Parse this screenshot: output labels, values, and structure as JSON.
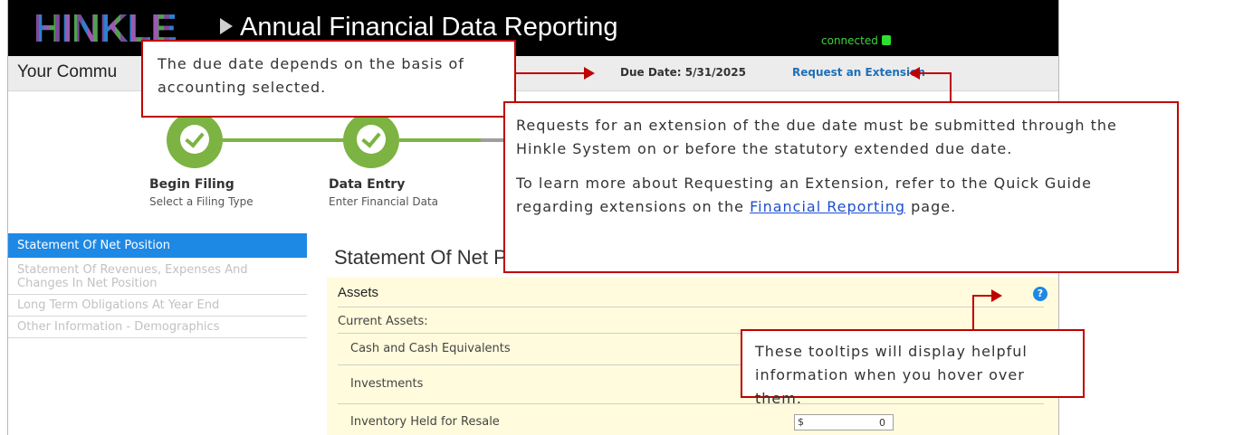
{
  "app": {
    "logo_text": "HINKLE",
    "title": "Annual Financial Data Reporting",
    "connection_status": "connected",
    "connection_color": "#2ee02e"
  },
  "subheader": {
    "community_label": "Your Commu",
    "due_date": "Due Date: 5/31/2025",
    "extension_link": "Request an Extension"
  },
  "steps": [
    {
      "title": "Begin Filing",
      "subtitle": "Select a Filing Type",
      "status": "complete",
      "icon": "check-icon"
    },
    {
      "title": "Data Entry",
      "subtitle": "Enter Financial Data",
      "status": "complete",
      "icon": "check-icon"
    }
  ],
  "sidebar": {
    "items": [
      {
        "label": "Statement Of Net Position",
        "active": true
      },
      {
        "label": "Statement Of Revenues, Expenses And Changes In Net Position",
        "active": false
      },
      {
        "label": "Long Term Obligations At Year End",
        "active": false
      },
      {
        "label": "Other Information - Demographics",
        "active": false
      }
    ]
  },
  "main": {
    "section_title": "Statement Of Net Pos",
    "group_title": "Assets",
    "subgroup_title": "Current Assets:",
    "rows": [
      {
        "label": "Cash and Cash Equivalents"
      },
      {
        "label": "Investments"
      },
      {
        "label": "Inventory Held for Resale",
        "currency": "$",
        "value": "0"
      }
    ],
    "help_icon_label": "?"
  },
  "callouts": {
    "due_date_note": "The due date depends on the basis of accounting selected.",
    "extension_note_p1": "Requests for an extension of the due date must be submitted through the Hinkle System on or before the statutory extended due date.",
    "extension_note_p2_before": "To learn more about Requesting an Extension, refer to the Quick Guide regarding extensions on the ",
    "extension_note_link": "Financial Reporting",
    "extension_note_p2_after": " page.",
    "tooltip_note": "These tooltips will display helpful information when you hover over them."
  },
  "colors": {
    "accent": "#1e88e5",
    "step_green": "#7cb342",
    "callout_red": "#c00000",
    "panel_bg": "#fffbdc"
  }
}
